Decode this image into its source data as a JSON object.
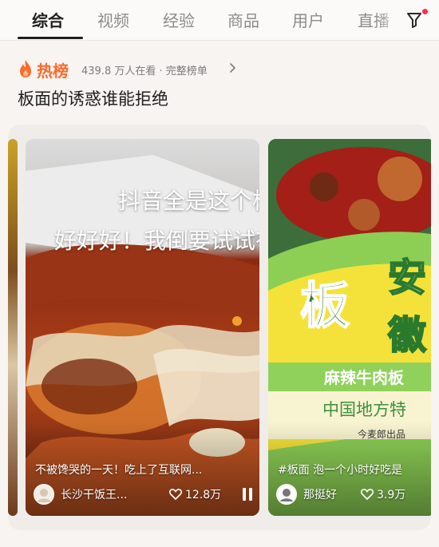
{
  "tabs": [
    {
      "label": "综合",
      "active": true
    },
    {
      "label": "视频",
      "active": false
    },
    {
      "label": "经验",
      "active": false
    },
    {
      "label": "商品",
      "active": false
    },
    {
      "label": "用户",
      "active": false
    },
    {
      "label": "直播",
      "active": false
    }
  ],
  "hot": {
    "label": "热榜",
    "meta": "439.8 万人在看 · 完整榜单",
    "accent": "#ff6a2a"
  },
  "headline": "板面的诱惑谁能拒绝",
  "cards": [
    {
      "overlay_line1": "抖音全是这个板面",
      "overlay_line2": "好好好！我倒要试试有多好吃",
      "caption": "不被馋哭的一天！吃上了互联网...",
      "author": "长沙干饭王...",
      "likes": "12.8万"
    },
    {
      "package_big1": "板",
      "package_big2": "安",
      "package_big3": "徽",
      "package_band": "麻辣牛肉板",
      "package_sub": "中国地方特",
      "package_brand": "今麦郎出品",
      "caption": "#板面 泡一个小时好吃是",
      "author": "那挺好",
      "likes": "3.9万"
    }
  ]
}
